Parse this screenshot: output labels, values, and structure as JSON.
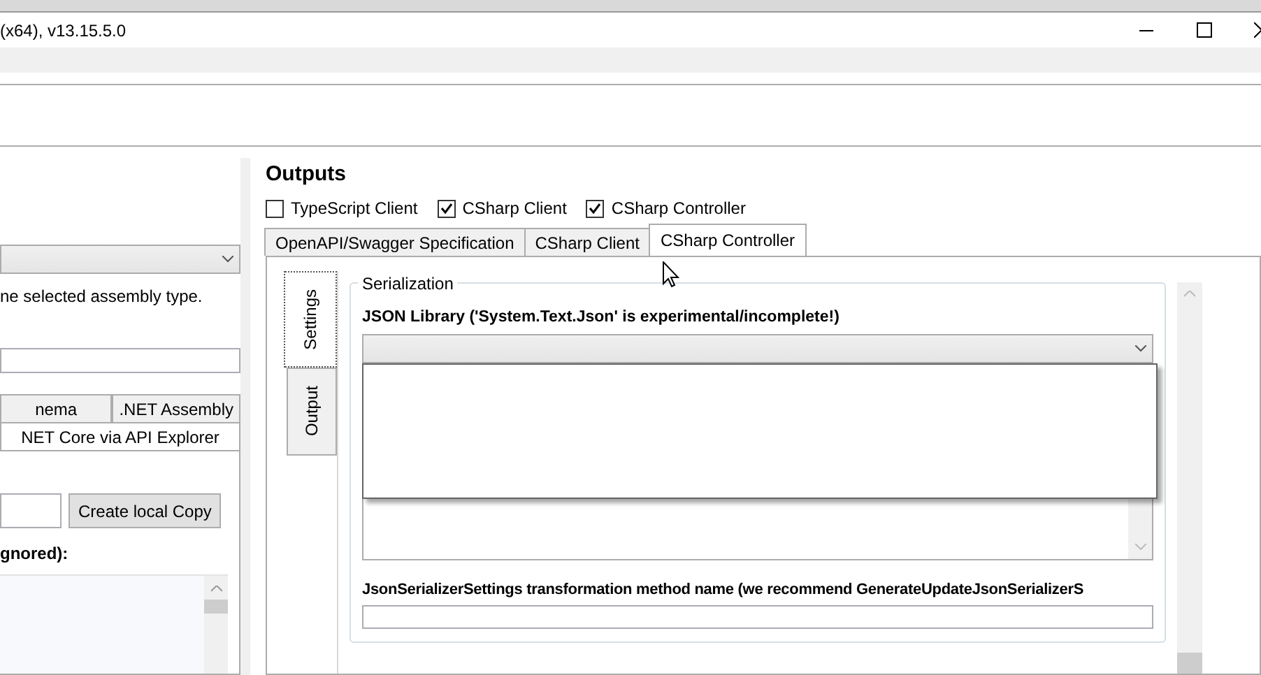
{
  "window": {
    "title": "(x64), v13.15.5.0"
  },
  "left_panel": {
    "description": "ne selected assembly type.",
    "input_tabs": [
      [
        {
          "label": "nema",
          "selected": false
        },
        {
          "label": ".NET Assembly",
          "selected": false
        }
      ],
      [
        {
          "label": "NET Core via API Explorer",
          "selected": true
        }
      ]
    ],
    "copy_button": "Create local Copy",
    "list_label": "gnored):"
  },
  "outputs": {
    "title": "Outputs",
    "checkboxes": [
      {
        "label": "TypeScript Client",
        "checked": false
      },
      {
        "label": "CSharp Client",
        "checked": true
      },
      {
        "label": "CSharp Controller",
        "checked": true
      }
    ],
    "tabs": [
      {
        "label": "OpenAPI/Swagger Specification",
        "selected": false
      },
      {
        "label": "CSharp Client",
        "selected": false
      },
      {
        "label": "CSharp Controller",
        "selected": true
      }
    ],
    "side_tabs": [
      {
        "label": "Settings",
        "selected": true
      },
      {
        "label": "Output",
        "selected": false
      }
    ],
    "group": {
      "title": "Serialization",
      "json_library_label": "JSON Library ('System.Text.Json' is experimental/incomplete!)",
      "transform_label": "JsonSerializerSettings transformation method name (we recommend GenerateUpdateJsonSerializerS"
    }
  }
}
